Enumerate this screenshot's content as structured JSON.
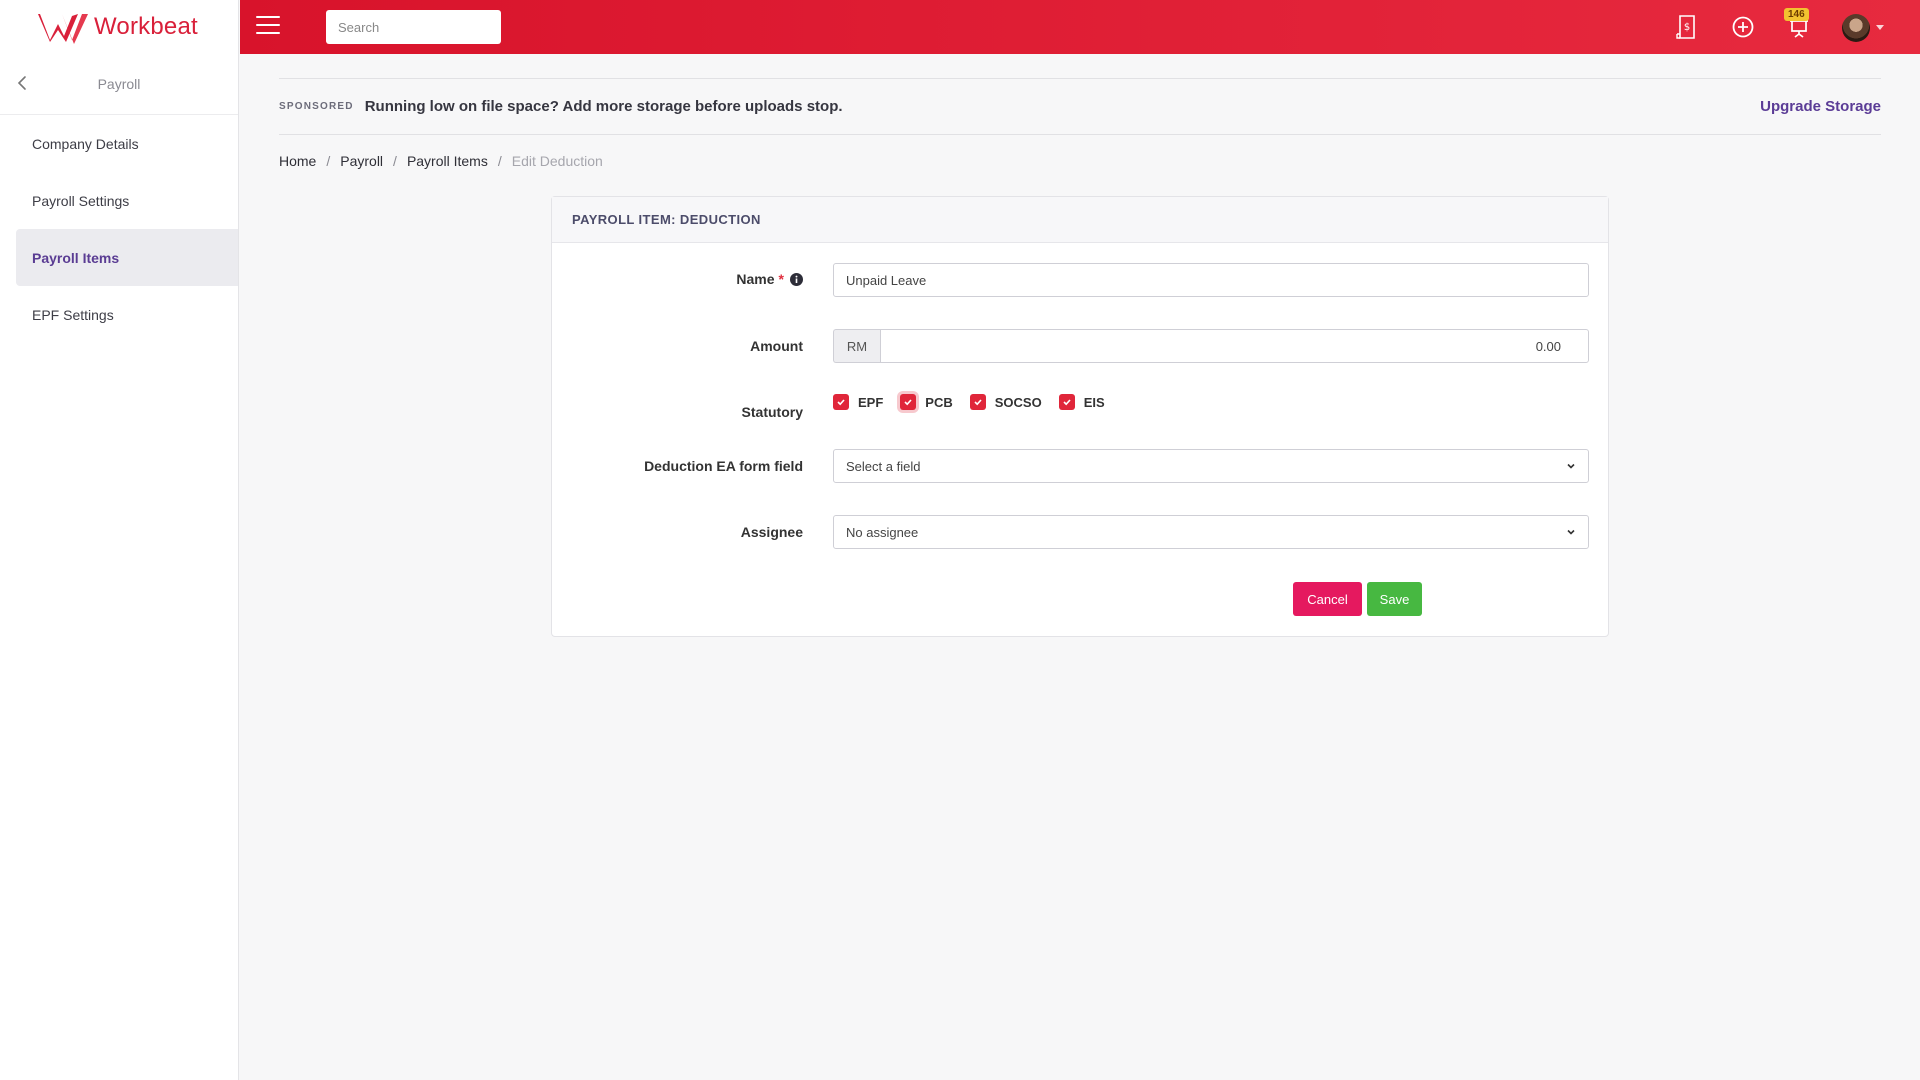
{
  "app": {
    "name": "Workbeat",
    "brand_color": "#d9203a",
    "accent_color": "#5b3c96"
  },
  "sidebar": {
    "section_title": "Payroll",
    "back_icon": "chevron-left-icon",
    "items": [
      {
        "label": "Company Details",
        "active": false
      },
      {
        "label": "Payroll Settings",
        "active": false
      },
      {
        "label": "Payroll Items",
        "active": true
      },
      {
        "label": "EPF Settings",
        "active": false
      }
    ]
  },
  "topbar": {
    "search_placeholder": "Search",
    "icons": [
      "invoice-icon",
      "add-circle-icon",
      "presentation-board-icon",
      "avatar"
    ],
    "notification_count": "146"
  },
  "sponsored": {
    "label": "SPONSORED",
    "message": "Running low on file space? Add more storage before uploads stop.",
    "link": "Upgrade Storage"
  },
  "breadcrumb": {
    "items": [
      "Home",
      "Payroll",
      "Payroll Items"
    ],
    "current": "Edit Deduction",
    "separator": "/"
  },
  "form": {
    "title": "PAYROLL ITEM: DEDUCTION",
    "name_label": "Name",
    "required_mark": "*",
    "name_value": "Unpaid Leave",
    "amount_label": "Amount",
    "currency": "RM",
    "amount_value": "0.00",
    "statutory_label": "Statutory",
    "statutory": [
      {
        "label": "EPF",
        "checked": true
      },
      {
        "label": "PCB",
        "checked": true
      },
      {
        "label": "SOCSO",
        "checked": true
      },
      {
        "label": "EIS",
        "checked": true
      }
    ],
    "ea_label": "Deduction EA form field",
    "ea_value": "Select a field",
    "assignee_label": "Assignee",
    "assignee_value": "No assignee",
    "cancel_label": "Cancel",
    "save_label": "Save"
  }
}
